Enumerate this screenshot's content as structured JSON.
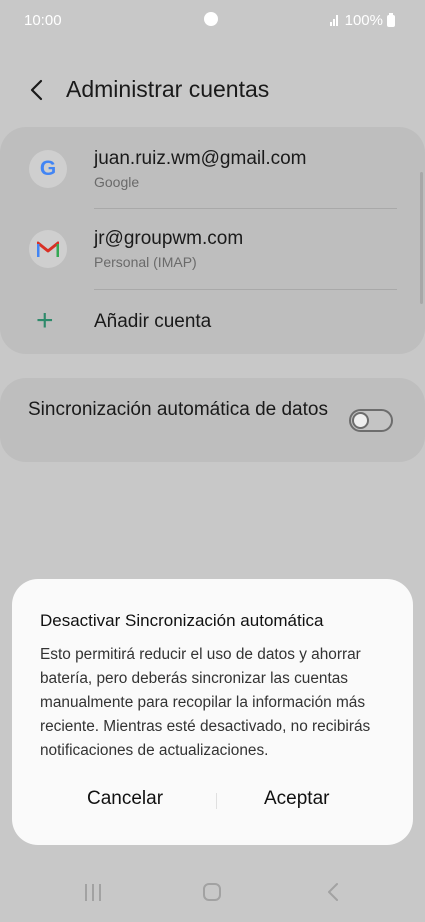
{
  "status_bar": {
    "time": "10:00",
    "battery": "100%"
  },
  "header": {
    "title": "Administrar cuentas"
  },
  "accounts": [
    {
      "email": "juan.ruiz.wm@gmail.com",
      "type": "Google",
      "icon": "google-icon"
    },
    {
      "email": "jr@groupwm.com",
      "type": "Personal (IMAP)",
      "icon": "gmail-icon"
    }
  ],
  "add_account": {
    "label": "Añadir cuenta"
  },
  "sync": {
    "label": "Sincronización automática de datos",
    "enabled": false
  },
  "dialog": {
    "title": "Desactivar Sincronización automática",
    "body": "Esto permitirá reducir el uso de datos y ahorrar batería, pero deberás sincronizar las cuentas manualmente para recopilar la información más reciente. Mientras esté desactivado, no recibirás notificaciones de actualizaciones.",
    "cancel": "Cancelar",
    "accept": "Aceptar"
  },
  "colors": {
    "accent": "#2e8a6b",
    "dialog_bg": "#fafafa",
    "scrim": "#c8c8c8"
  }
}
